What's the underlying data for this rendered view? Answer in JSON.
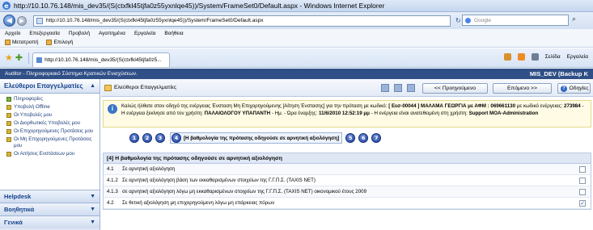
{
  "window": {
    "title": "http://10.10.76.148/mis_dev35/(S(ctxfkl45tjfa0z55yxnlqe45))/System/FrameSet0/Default.aspx - Windows Internet Explorer"
  },
  "browser": {
    "url": "http://10.10.76.148/mis_dev35/(S(ctxfkl45tjfa0z55yxnlqe45))/System/FrameSet0/Default.aspx",
    "search_placeholder": "Google",
    "menu": [
      "Αρχείο",
      "Επεξεργασία",
      "Προβολή",
      "Αγαπημένα",
      "Εργαλεία",
      "Βοήθεια"
    ],
    "links": [
      "Μετατροπή",
      "Επιλογή"
    ],
    "tab_title": "http://10.10.76.148/mis_dev35/(S(ctxfkl45tjfa0z5...",
    "commands": [
      "Σελίδα",
      "Εργαλεία"
    ]
  },
  "app": {
    "header_title": "Auditor - Πληροφοριακό Σύστημα Κρατικών Ενισχύσεων.",
    "header_right": "MIS_DEV (Backup K"
  },
  "sidebar": {
    "panel_title": "Ελεύθεροι Επαγγελματίες",
    "items": [
      "Πληροφορίες",
      "Υποβολή Offline",
      "Οι Υποβολές μου",
      "Οι Διορθωτικές Υποβολές μου",
      "Οι Επιχορηγούμενες Προτάσεις μου",
      "Οι Μη Επιχορηγούμενες Προτάσεις μου",
      "Οι Αιτήσεις Ενστάσεων μου"
    ],
    "sections": [
      "Helpdesk",
      "Βοηθητικά",
      "Γενικά"
    ]
  },
  "main": {
    "title": "Ελεύθεροι Επαγγελματίες",
    "prev_label": "<< Προηγούμενο",
    "next_label": "Επόμενο >>",
    "help_label": "Οδηγίες",
    "info": {
      "intro": "Καλώς ήλθατε στον οδηγό της ενέργειας Ένσταση Μη Επιχορηγούμενης [Αίτηση Ένστασης] για την πρόταση με κωδικό:",
      "code_name": "[ Εεσ-00044 ]  ΜΑΛΑΜΑ ΓΕΩΡΓΙΑ με ΑΦΜ : 069661130",
      "mid": "με κωδικό ενέργειας:",
      "action_code": "273984",
      "started_by": "- Η ενέργεια ξεκίνησε από τον χρήστη:",
      "user": "ΠΑΛΑΙΟΛΟΓΟΥ ΥΠΑΠΑΝΤΗ",
      "date_label": "- Ημ. - Ώρα έναρξης:",
      "date": "11/6/2010 12:52:19 μμ",
      "assigned_label": "- Η ενέργεια είναι ανατεθειμένη στη χρήστη:",
      "assigned": "Support MOA-Administration"
    },
    "steps": [
      "1",
      "2",
      "3",
      "4",
      "5",
      "6",
      "7"
    ],
    "active_step_label": "[Η βαθμολογία της πρότασης οδηγούσε σε αρνητική αξιολόγηση]",
    "question": {
      "header": "[4] Η βαθμολογία της πρότασης οδηγούσε σε αρνητική αξιολόγηση",
      "rows": [
        {
          "num": "4.1",
          "text": "Σε αρνητική αξιολόγηση",
          "checked": false
        },
        {
          "num": "4.1.2",
          "text": "Σε αρνητική αξιολόγηση βάση των εκκαθαρισμένων στοιχείων της Γ.Γ.Π.Σ. (TAXIS NET)",
          "checked": false
        },
        {
          "num": "4.1.3",
          "text": "σε αρνητική αξιολόγηση λόγω μη εκκαθαρισμένων στοιχείων της Γ.Γ.Π.Σ. (TAXIS NET) οικονομικού έτους 2009",
          "checked": false
        },
        {
          "num": "4.2",
          "text": "Σε θετική αξιολόγηση μη επιχορηγούμενη λόγω μη επάρκειας πόρων",
          "checked": true
        }
      ]
    }
  },
  "colors": {
    "app_header": "#2f4f86",
    "sidebar_title": "#15428b",
    "info_bg": "#fffbe4"
  }
}
